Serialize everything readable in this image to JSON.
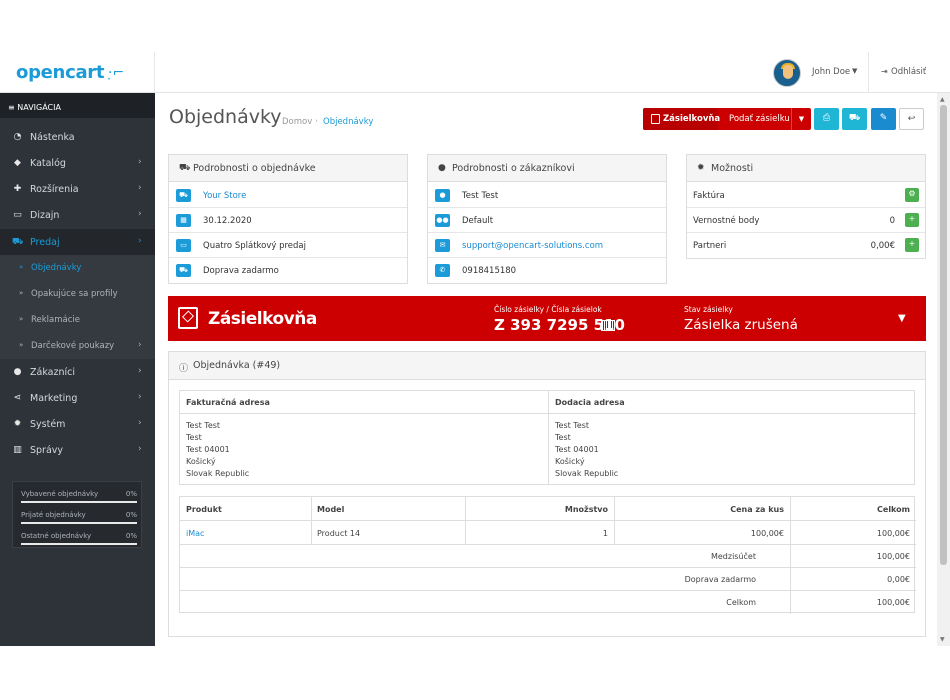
{
  "header": {
    "logo": "opencart",
    "user_name": "John Doe",
    "logout_label": "Odhlásiť"
  },
  "sidebar": {
    "nav_header": "NAVIGÁCIA",
    "items": [
      {
        "label": "Nástenka",
        "icon": "dashboard-icon"
      },
      {
        "label": "Katalóg",
        "icon": "tag-icon"
      },
      {
        "label": "Rozšírenia",
        "icon": "puzzle-icon"
      },
      {
        "label": "Dizajn",
        "icon": "monitor-icon"
      },
      {
        "label": "Predaj",
        "icon": "cart-icon"
      },
      {
        "label": "Zákazníci",
        "icon": "user-icon"
      },
      {
        "label": "Marketing",
        "icon": "share-icon"
      },
      {
        "label": "Systém",
        "icon": "gear-icon"
      },
      {
        "label": "Správy",
        "icon": "bar-chart-icon"
      }
    ],
    "sub_items": [
      {
        "label": "Objednávky"
      },
      {
        "label": "Opakujúce sa profily"
      },
      {
        "label": "Reklamácie"
      },
      {
        "label": "Darčekové poukazy"
      }
    ],
    "stats": [
      {
        "label": "Vybavené objednávky",
        "value": "0%"
      },
      {
        "label": "Prijaté objednávky",
        "value": "0%"
      },
      {
        "label": "Ostatné objednávky",
        "value": "0%"
      }
    ]
  },
  "main": {
    "title": "Objednávky",
    "breadcrumb_home": "Domov",
    "breadcrumb_current": "Objednávky",
    "zas_button_logo": "Zásielkovňa",
    "zas_button_label": "Podať zásielku"
  },
  "order_details": {
    "title": "Podrobnosti o objednávke",
    "rows": [
      {
        "text": "Your Store",
        "icon": "cart-icon"
      },
      {
        "text": "30.12.2020",
        "icon": "calendar-icon"
      },
      {
        "text": "Quatro Splátkový predaj",
        "icon": "credit-card-icon"
      },
      {
        "text": "Doprava zadarmo",
        "icon": "truck-icon"
      }
    ]
  },
  "customer_details": {
    "title": "Podrobnosti o zákazníkovi",
    "rows": [
      {
        "text": "Test Test",
        "icon": "user-icon"
      },
      {
        "text": "Default",
        "icon": "group-icon"
      },
      {
        "text": "support@opencart-solutions.com",
        "icon": "envelope-icon"
      },
      {
        "text": "0918415180",
        "icon": "phone-icon"
      }
    ]
  },
  "options": {
    "title": "Možnosti",
    "rows": [
      {
        "label": "Faktúra",
        "value": ""
      },
      {
        "label": "Vernostné body",
        "value": "0"
      },
      {
        "label": "Partneri",
        "value": "0,00€"
      }
    ]
  },
  "zasielkovna": {
    "name": "Zásielkovňa",
    "number_label": "Číslo zásielky / Čísla zásielok",
    "number": "Z 393 7295 510",
    "state_label": "Stav zásielky",
    "state": "Zásielka zrušená"
  },
  "order": {
    "title": "Objednávka (#49)",
    "payment_address_title": "Fakturačná adresa",
    "shipping_address_title": "Dodacia adresa",
    "payment_address": [
      "Test Test",
      "Test",
      "Test 04001",
      "Košický",
      "Slovak Republic"
    ],
    "shipping_address": [
      "Test Test",
      "Test",
      "Test 04001",
      "Košický",
      "Slovak Republic"
    ],
    "columns": [
      "Produkt",
      "Model",
      "Množstvo",
      "Cena za kus",
      "Celkom"
    ],
    "product": {
      "name": "iMac",
      "model": "Product 14",
      "quantity": "1",
      "price": "100,00€",
      "total": "100,00€"
    },
    "totals": [
      {
        "label": "Medzisúčet",
        "value": "100,00€"
      },
      {
        "label": "Doprava zadarmo",
        "value": "0,00€"
      },
      {
        "label": "Celkom",
        "value": "100,00€"
      }
    ]
  }
}
